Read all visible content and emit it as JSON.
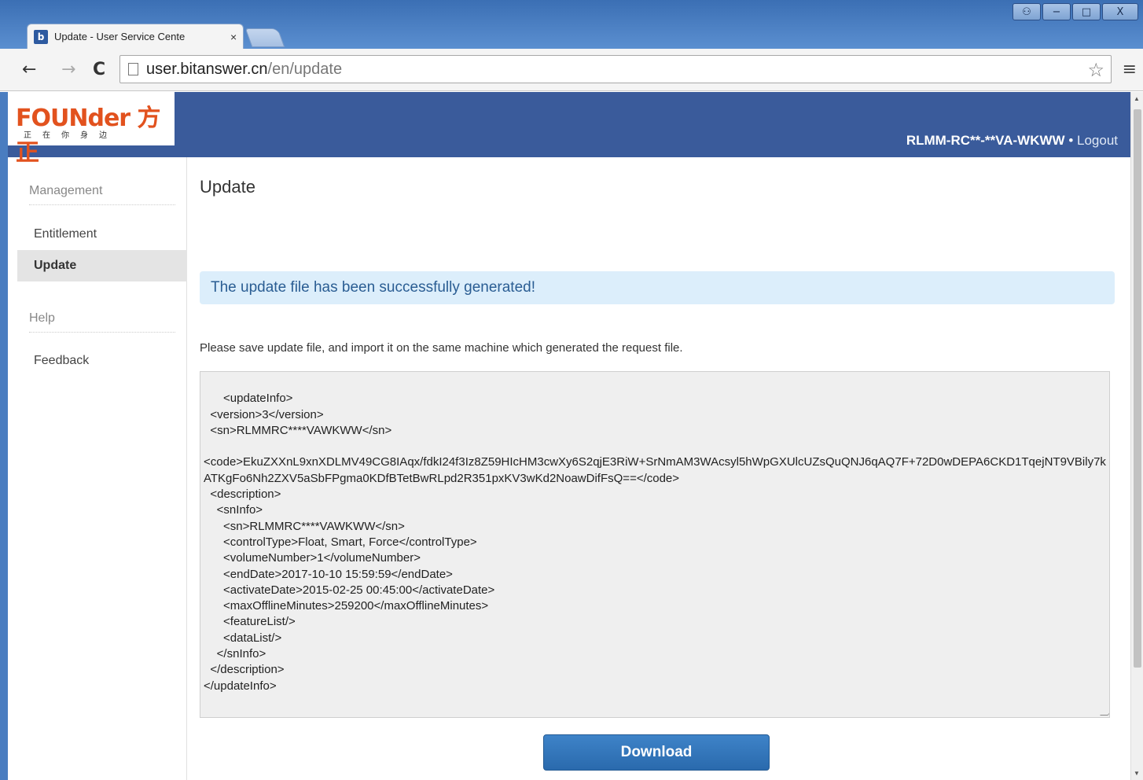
{
  "browser": {
    "tab_title": "Update - User Service Cente",
    "tab_close": "×",
    "url_host": "user.bitanswer.cn",
    "url_path": "/en/update",
    "back_glyph": "←",
    "forward_glyph": "→",
    "reload_glyph": "C",
    "star_glyph": "☆",
    "menu_glyph": "≡",
    "win_user": "⚇",
    "win_min": "−",
    "win_max": "□",
    "win_close": "X"
  },
  "header": {
    "logo_text": "FOUNder 方正",
    "logo_sub": "正在你身边",
    "user_id": "RLMM-RC**-**VA-WKWW",
    "separator": " • ",
    "logout": "Logout"
  },
  "sidebar": {
    "management": "Management",
    "entitlement": "Entitlement",
    "update": "Update",
    "help": "Help",
    "feedback": "Feedback"
  },
  "main": {
    "title": "Update",
    "alert": "The update file has been successfully generated!",
    "instruction": "Please save update file, and import it on the same machine which generated the request file.",
    "xml": "<updateInfo>\n  <version>3</version>\n  <sn>RLMMRC****VAWKWW</sn>\n\n<code>EkuZXXnL9xnXDLMV49CG8IAqx/fdkI24f3Iz8Z59HIcHM3cwXy6S2qjE3RiW+SrNmAM3WAcsyl5hWpGXUlcUZsQuQNJ6qAQ7F+72D0wDEPA6CKD1TqejNT9VBily7kATKgFo6Nh2ZXV5aSbFPgma0KDfBTetBwRLpd2R351pxKV3wKd2NoawDifFsQ==</code>\n  <description>\n    <snInfo>\n      <sn>RLMMRC****VAWKWW</sn>\n      <controlType>Float, Smart, Force</controlType>\n      <volumeNumber>1</volumeNumber>\n      <endDate>2017-10-10 15:59:59</endDate>\n      <activateDate>2015-02-25 00:45:00</activateDate>\n      <maxOfflineMinutes>259200</maxOfflineMinutes>\n      <featureList/>\n      <dataList/>\n    </snInfo>\n  </description>\n</updateInfo>",
    "download_label": "Download"
  }
}
